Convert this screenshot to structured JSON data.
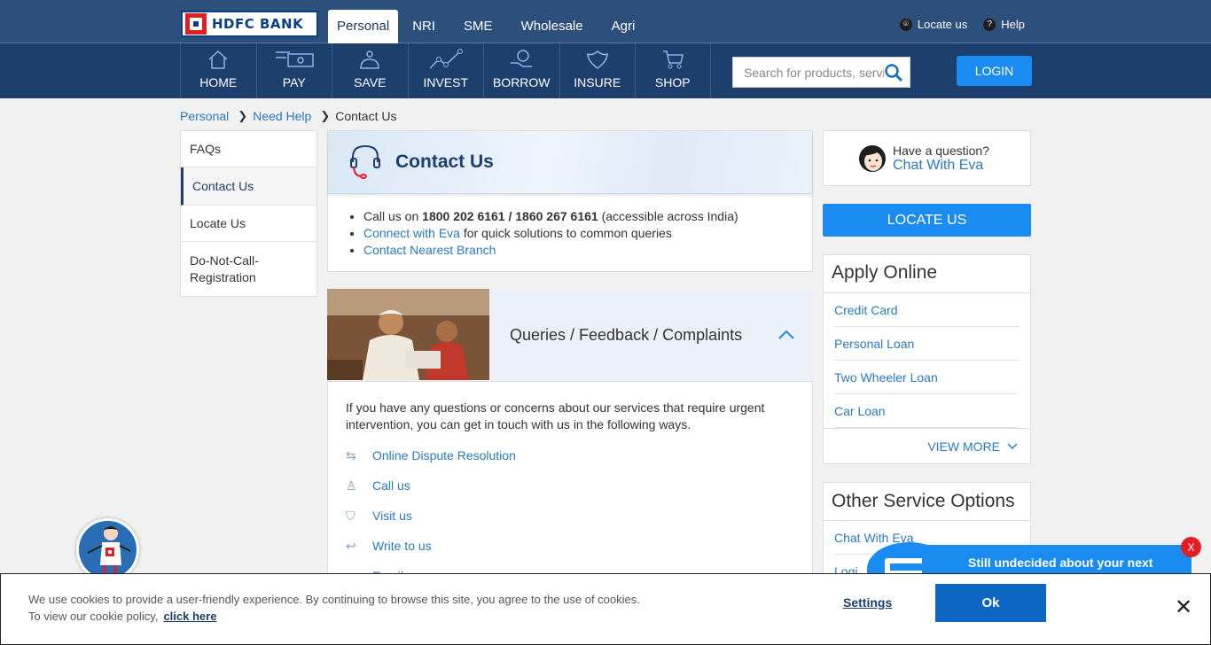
{
  "brand": {
    "name": "HDFC BANK"
  },
  "top_tabs": [
    "Personal",
    "NRI",
    "SME",
    "Wholesale",
    "Agri"
  ],
  "top_links": {
    "locate": "Locate us",
    "help": "Help"
  },
  "nav": {
    "items": [
      "HOME",
      "PAY",
      "SAVE",
      "INVEST",
      "BORROW",
      "INSURE",
      "SHOP"
    ],
    "search_placeholder": "Search for products, services",
    "login": "LOGIN"
  },
  "breadcrumb": {
    "items": [
      "Personal",
      "Need Help"
    ],
    "current": "Contact Us"
  },
  "left_menu": [
    "FAQs",
    "Contact Us",
    "Locate Us",
    "Do-Not-Call-Registration"
  ],
  "contact": {
    "title": "Contact Us",
    "call_prefix": "Call us on ",
    "call_numbers": "1800 202 6161 / 1860 267 6161",
    "call_suffix": " (accessible across India)",
    "connect_link": "Connect with Eva",
    "connect_suffix": " for quick solutions to common queries",
    "branch_link": "Contact Nearest Branch"
  },
  "queries": {
    "title": "Queries / Feedback / Complaints",
    "intro": "If you have any questions or concerns about our services that require urgent intervention, you can get in touch with us in the following ways.",
    "options": [
      "Online Dispute Resolution",
      "Call us",
      "Visit us",
      "Write to us",
      "Email us"
    ]
  },
  "eva": {
    "question": "Have a question?",
    "link": "Chat With Eva"
  },
  "locate_btn": "LOCATE US",
  "apply_online": {
    "title": "Apply Online",
    "items": [
      "Credit Card",
      "Personal Loan",
      "Two Wheeler Loan",
      "Car Loan"
    ],
    "view_more": "VIEW MORE"
  },
  "other_services": {
    "title": "Other Service Options",
    "items": [
      "Chat With Eva",
      "Logi"
    ]
  },
  "promo": {
    "text": "Still undecided about your next",
    "close": "X"
  },
  "cookie": {
    "text": "We use cookies to provide a user-friendly experience. By continuing to browse this site, you agree to the use of cookies. To view our cookie policy,",
    "link": "click here",
    "settings": "Settings",
    "ok": "Ok",
    "close": "✕"
  },
  "colors": {
    "topbar": "#2d4f7b",
    "navbar": "#1d3f6e",
    "accent": "#1a8bf0",
    "link": "#2979c5"
  }
}
